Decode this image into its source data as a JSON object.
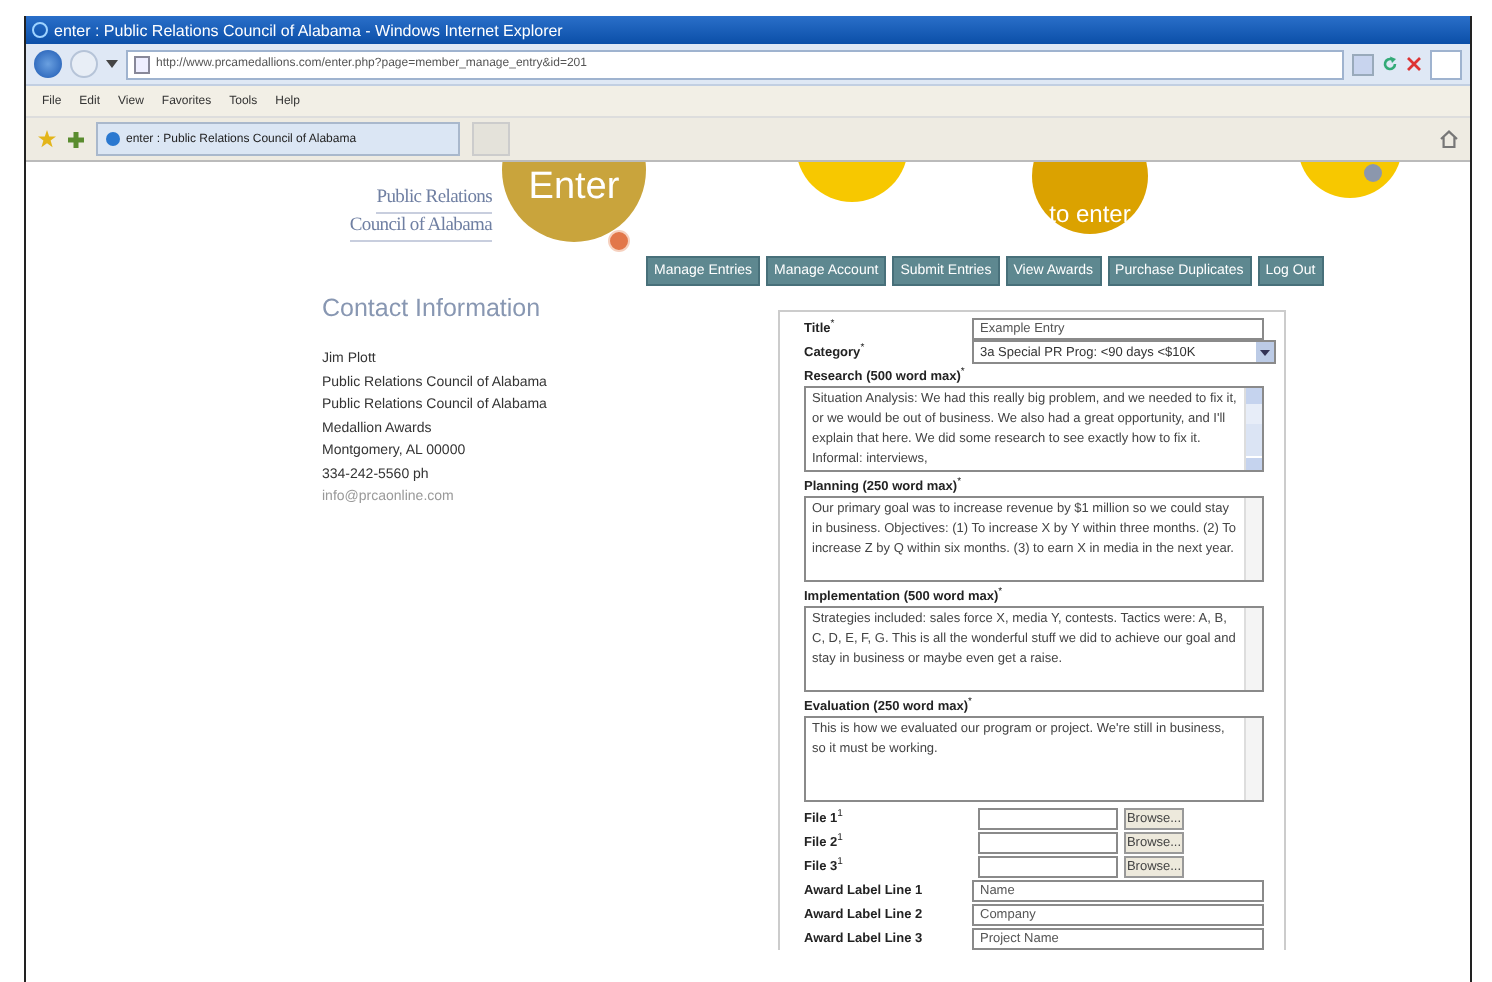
{
  "window": {
    "title": "enter : Public Relations Council of Alabama - Windows Internet Explorer"
  },
  "address_bar": {
    "url": "http://www.prcamedallions.com/enter.php?page=member_manage_entry&id=201"
  },
  "menu": [
    "File",
    "Edit",
    "View",
    "Favorites",
    "Tools",
    "Help"
  ],
  "tabs": [
    {
      "label": "enter : Public Relations Council of Alabama",
      "selected": true
    }
  ],
  "site": {
    "logo": [
      "Public Relations",
      "Council of Alabama"
    ],
    "badges": [
      {
        "kind": "enter",
        "label": "Enter"
      },
      {
        "kind": "plain"
      },
      {
        "kind": "how",
        "label": "to enter"
      },
      {
        "kind": "plain"
      }
    ]
  },
  "nav": [
    "Manage Entries",
    "Manage Account",
    "Submit Entries",
    "View Awards",
    "Purchase Duplicates",
    "Log Out"
  ],
  "contact": {
    "heading": "Contact Information",
    "lines": [
      "Jim Plott",
      "Public Relations Council of Alabama",
      "Public Relations Council of Alabama",
      "Medallion Awards",
      "Montgomery, AL 00000",
      "334-242-5560 ph"
    ],
    "email": "info@prcaonline.com"
  },
  "form": {
    "fields": [
      {
        "kind": "text",
        "label": "Title$^{*}$",
        "value": "Example Entry"
      },
      {
        "kind": "select",
        "label": "Category$^{*}$",
        "value": "3a Special PR Prog: <90 days <$10K"
      },
      {
        "kind": "textarea",
        "label": "Research (500 word max)$^{*}$",
        "value": "Situation Analysis: We had this really big problem, and we needed to fix it, or we would be out of business. We also had a great opportunity, and I'll explain that here. We did some research to see exactly how to fix it. Informal: interviews,",
        "scrollable": true
      },
      {
        "kind": "textarea",
        "label": "Planning (250 word max)$^{*}$",
        "value": "Our primary goal was to increase revenue by $1 million so we could stay in business. Objectives: (1) To increase X by Y within three months. (2) To increase Z by Q within six months. (3) to earn X in media in the next year.",
        "scrollable": false
      },
      {
        "kind": "textarea",
        "label": "Implementation (500 word max)$^{*}$",
        "value": "Strategies included: sales force X, media Y, contests. Tactics were: A, B, C, D, E, F, G. This is all the wonderful stuff we did to achieve our goal and stay in business or maybe even get a raise.",
        "scrollable": false
      },
      {
        "kind": "textarea",
        "label": "Evaluation (250 word max)$^{*}$",
        "value": "This is how we evaluated our program or project. We're still in business, so it must be working.",
        "scrollable": false
      },
      {
        "kind": "file",
        "label": "File 1$^{1}$",
        "button": "Browse..."
      },
      {
        "kind": "file",
        "label": "File 2$^{1}$",
        "button": "Browse..."
      },
      {
        "kind": "file",
        "label": "File 3$^{1}$",
        "button": "Browse..."
      },
      {
        "kind": "text",
        "label": "Award Label Line 1",
        "value": "Name"
      },
      {
        "kind": "text",
        "label": "Award Label Line 2",
        "value": "Company"
      },
      {
        "kind": "text",
        "label": "Award Label Line 3",
        "value": "Project Name"
      }
    ]
  }
}
